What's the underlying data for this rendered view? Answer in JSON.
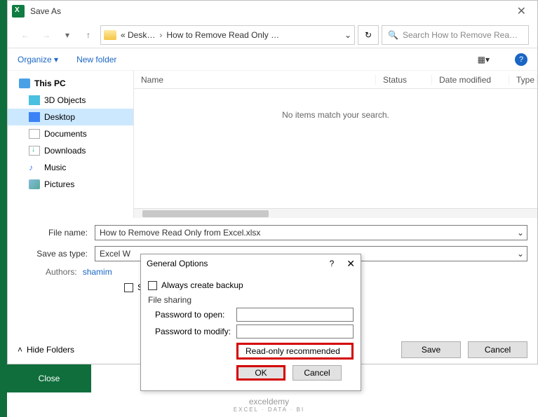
{
  "titlebar": {
    "title": "Save As"
  },
  "breadcrumb": {
    "part1": "« Desk…",
    "part2": "How to Remove Read Only …"
  },
  "search": {
    "placeholder": "Search How to Remove Rea…"
  },
  "toolbar": {
    "organize": "Organize ▾",
    "newfolder": "New folder"
  },
  "sidebar": {
    "root": "This PC",
    "items": [
      "3D Objects",
      "Desktop",
      "Documents",
      "Downloads",
      "Music",
      "Pictures"
    ]
  },
  "columns": {
    "name": "Name",
    "status": "Status",
    "date": "Date modified",
    "type": "Type"
  },
  "empty_msg": "No items match your search.",
  "form": {
    "filename_label": "File name:",
    "filename_value": "How to Remove Read Only from Excel.xlsx",
    "saveastype_label": "Save as type:",
    "saveastype_value": "Excel W",
    "authors_label": "Authors:",
    "authors_value": "shamim",
    "thumb_label": "S"
  },
  "footer": {
    "hide": "Hide Folders",
    "save": "Save",
    "cancel": "Cancel"
  },
  "close": "Close",
  "dialog": {
    "title": "General Options",
    "backup": "Always create backup",
    "filesharing": "File sharing",
    "pwd_open": "Password to open:",
    "pwd_modify": "Password to modify:",
    "readonly": "Read-only recommended",
    "ok": "OK",
    "cancel": "Cancel"
  },
  "watermark": {
    "main": "exceldemy",
    "sub": "EXCEL · DATA · BI"
  }
}
